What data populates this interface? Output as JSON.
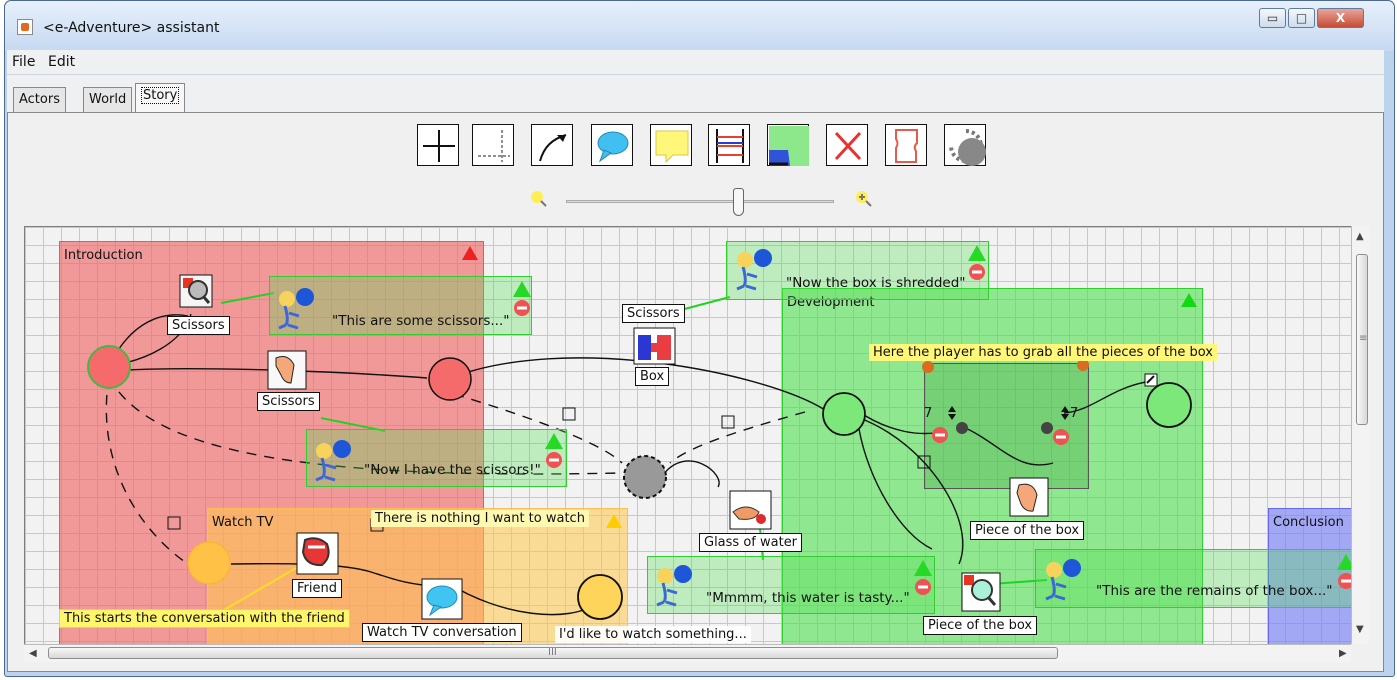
{
  "window": {
    "title": "<e-Adventure> assistant",
    "controls": {
      "minimize": "▭",
      "maximize": "□",
      "close": "X"
    }
  },
  "menu": [
    "File",
    "Edit"
  ],
  "tabs": [
    {
      "label": "Actors"
    },
    {
      "label": "World"
    },
    {
      "label": "Story"
    }
  ],
  "toolbar": {
    "tools": [
      "cross-tool",
      "corner-tool",
      "arrow-tool",
      "speech-tool",
      "note-tool",
      "timeline-tool",
      "region-tool",
      "delete-tool",
      "shape-tool",
      "dashed-tool"
    ],
    "zoom": {
      "out_icon": "zoom-out-icon",
      "in_icon": "zoom-in-icon",
      "level": 0.62
    }
  },
  "story": {
    "areas": {
      "introduction": "Introduction",
      "development": "Development",
      "watch_tv": "Watch TV",
      "conclusion": "Conclusion"
    },
    "labels": {
      "scissors_1": "Scissors",
      "scissors_2": "Scissors",
      "scissors_3": "Scissors",
      "box": "Box",
      "friend": "Friend",
      "watch_tv_conversation": "Watch TV conversation",
      "glass_of_water": "Glass of water",
      "piece_of_box_1": "Piece of the box",
      "piece_of_box_2": "Piece of the box"
    },
    "notes": {
      "grab_pieces": "Here the player has to grab all the pieces of the box",
      "nothing_to_watch": "There is nothing I want to watch",
      "start_conversation": "This starts the conversation with the friend",
      "want_to_watch": "I'd like to watch something..."
    },
    "speech": {
      "scissors": "\"This are some scissors...\"",
      "have_scissors": "\"Now I have the scissors!\"",
      "box_shredded": "\"Now the box is shredded\"",
      "water": "\"Mmmm, this water is tasty...\"",
      "remains": "\"This are the remains of the box...\""
    },
    "counters": {
      "left": "7",
      "right": "7"
    }
  },
  "scroll": {
    "h_icon": "scroll-grip-icon",
    "h_grip": "III",
    "v_grip": "≡"
  }
}
